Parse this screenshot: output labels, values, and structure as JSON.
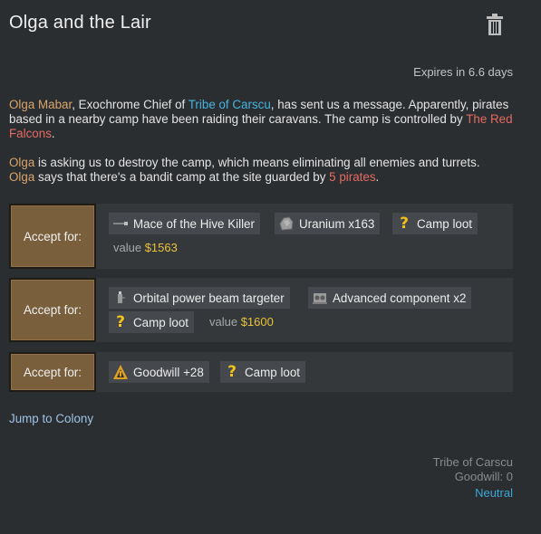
{
  "quest": {
    "title": "Olga and the Lair",
    "expires": "Expires in 6.6 days"
  },
  "message": {
    "p1": {
      "person": "Olga Mabar",
      "t1": ", Exochrome Chief of ",
      "faction": "Tribe of Carscu",
      "t2": ", has sent us a message. Apparently, pirates based in a nearby camp have been raiding their caravans. The camp is controlled by ",
      "enemy": "The Red Falcons",
      "t3": "."
    },
    "p2": {
      "person1": "Olga",
      "t1": " is asking us to destroy the camp, which means eliminating all enemies and turrets.",
      "person2": "Olga",
      "t2": " says that there's a bandit camp at the site guarded by ",
      "pirates": "5 pirates",
      "t3": "."
    }
  },
  "offers": [
    {
      "accept_label": "Accept for:",
      "items": [
        {
          "icon": "mace-icon",
          "label": "Mace of the Hive Killer"
        },
        {
          "icon": "uranium-icon",
          "label": "Uranium x163"
        },
        {
          "icon": "question-icon",
          "label": "Camp loot"
        }
      ],
      "value_label": "value",
      "value_amount": "$1563"
    },
    {
      "accept_label": "Accept for:",
      "items": [
        {
          "icon": "beam-targeter-icon",
          "label": "Orbital power beam targeter"
        },
        {
          "icon": "component-icon",
          "label": "Advanced component x2"
        },
        {
          "icon": "question-icon",
          "label": "Camp loot"
        }
      ],
      "value_label": "value",
      "value_amount": "$1600"
    },
    {
      "accept_label": "Accept for:",
      "items": [
        {
          "icon": "goodwill-icon",
          "label": "Goodwill +28"
        },
        {
          "icon": "question-icon",
          "label": "Camp loot"
        }
      ]
    }
  ],
  "jump_label": "Jump to Colony",
  "faction_info": {
    "name": "Tribe of Carscu",
    "goodwill": "Goodwill: 0",
    "relation": "Neutral"
  },
  "colors": {
    "background": "#2b2e31",
    "person": "#d9a56b",
    "faction": "#43b5e0",
    "hostile": "#e46a62",
    "value": "#e8c23a",
    "button": "#7a5f3c",
    "neutral": "#3aa7d6"
  }
}
